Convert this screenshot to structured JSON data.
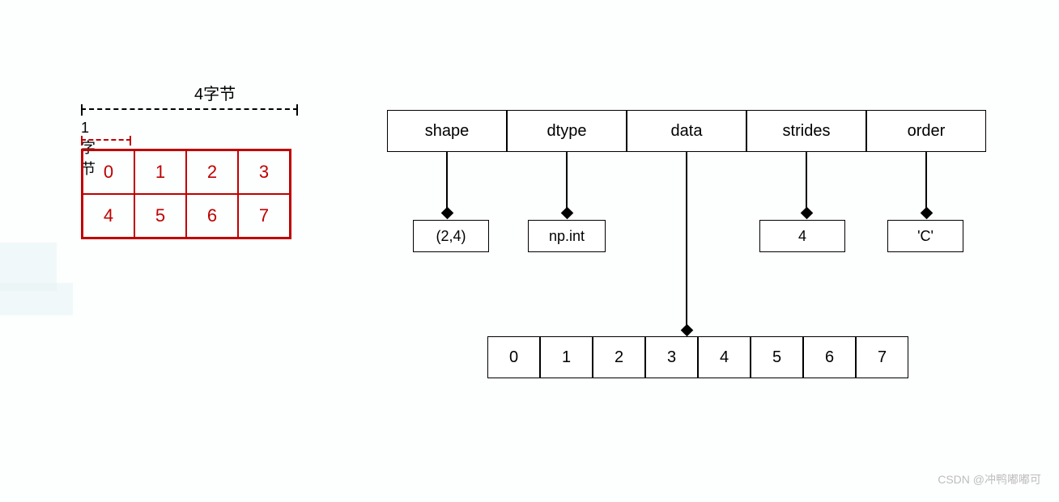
{
  "left": {
    "top_label": "4字节",
    "small_label": "1字节",
    "cells": [
      "0",
      "1",
      "2",
      "3",
      "4",
      "5",
      "6",
      "7"
    ]
  },
  "right": {
    "headers": [
      "shape",
      "dtype",
      "data",
      "strides",
      "order"
    ],
    "shape_value": "(2,4)",
    "dtype_value": "np.int",
    "strides_value": "4",
    "order_value": "'C'",
    "data_row": [
      "0",
      "1",
      "2",
      "3",
      "4",
      "5",
      "6",
      "7"
    ]
  },
  "watermark": "CSDN @冲鸭嘟嘟可",
  "chart_data": {
    "type": "table",
    "description": "NumPy ndarray internal structure diagram",
    "array_2d": [
      [
        0,
        1,
        2,
        3
      ],
      [
        4,
        5,
        6,
        7
      ]
    ],
    "bytes_per_element": 1,
    "bytes_per_row": 4,
    "ndarray_attributes": {
      "shape": "(2,4)",
      "dtype": "np.int",
      "data": [
        0,
        1,
        2,
        3,
        4,
        5,
        6,
        7
      ],
      "strides": 4,
      "order": "C"
    }
  }
}
